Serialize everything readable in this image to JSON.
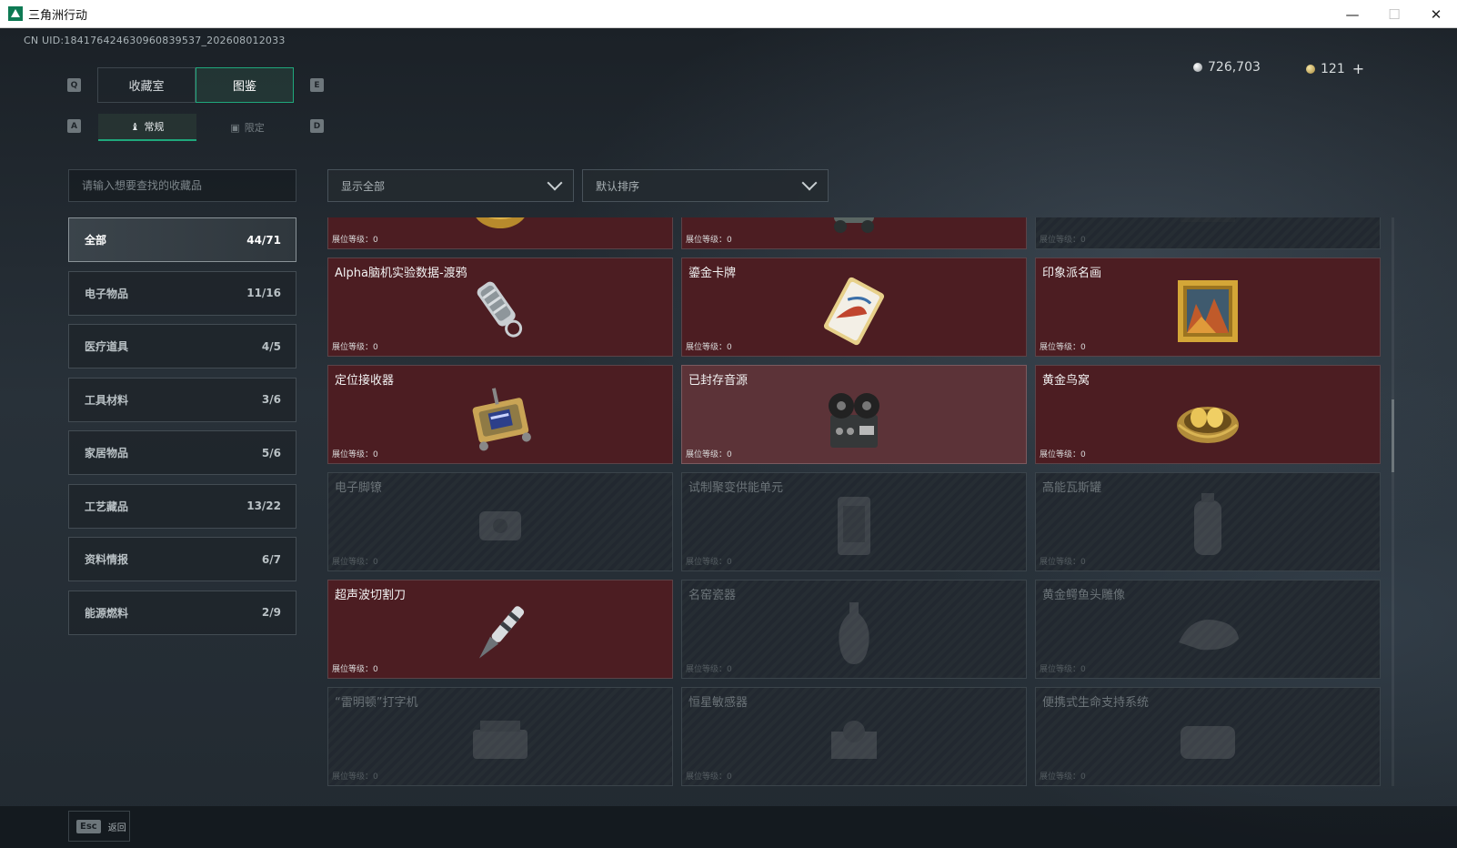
{
  "window": {
    "title": "三角洲行动",
    "minimize": "—",
    "maximize": "☐",
    "close": "✕"
  },
  "uid": "CN UID:184176424630960839537_202608012033",
  "currency": {
    "silver": "726,703",
    "gold": "121",
    "add": "+"
  },
  "keys": {
    "prev_main": "Q",
    "next_main": "E",
    "prev_sub": "A",
    "next_sub": "D"
  },
  "tabs": {
    "main": [
      {
        "label": "收藏室"
      },
      {
        "label": "图鉴"
      }
    ],
    "sub": [
      {
        "label": "常规",
        "icon": "♝"
      },
      {
        "label": "限定",
        "icon": "▣"
      }
    ]
  },
  "search": {
    "placeholder": "请输入想要查找的收藏品"
  },
  "filters": {
    "display": "显示全部",
    "sort": "默认排序"
  },
  "categories": [
    {
      "label": "全部",
      "count": "44/71"
    },
    {
      "label": "电子物品",
      "count": "11/16"
    },
    {
      "label": "医疗道具",
      "count": "4/5"
    },
    {
      "label": "工具材料",
      "count": "3/6"
    },
    {
      "label": "家居物品",
      "count": "5/6"
    },
    {
      "label": "工艺藏品",
      "count": "13/22"
    },
    {
      "label": "资料情报",
      "count": "6/7"
    },
    {
      "label": "能源燃料",
      "count": "2/9"
    }
  ],
  "level_label": "展位等级：",
  "items": [
    {
      "name": "",
      "level": "0",
      "icon": "caviar-tin-icon"
    },
    {
      "name": "",
      "level": "0",
      "icon": "robot-device-icon"
    },
    {
      "name": "",
      "level": "0",
      "icon": "unknown-item-icon"
    },
    {
      "name": "Alpha脑机实验数据-渡鸦",
      "level": "0",
      "icon": "flash-drive-icon"
    },
    {
      "name": "鎏金卡牌",
      "level": "0",
      "icon": "gilded-card-icon"
    },
    {
      "name": "印象派名画",
      "level": "0",
      "icon": "framed-painting-icon"
    },
    {
      "name": "定位接收器",
      "level": "0",
      "icon": "gps-receiver-icon"
    },
    {
      "name": "已封存音源",
      "level": "0",
      "icon": "reel-recorder-icon"
    },
    {
      "name": "黄金鸟窝",
      "level": "0",
      "icon": "golden-nest-icon"
    },
    {
      "name": "电子脚镣",
      "level": "0",
      "icon": "ankle-monitor-icon"
    },
    {
      "name": "试制聚变供能单元",
      "level": "0",
      "icon": "fusion-cell-icon"
    },
    {
      "name": "高能瓦斯罐",
      "level": "0",
      "icon": "gas-canister-icon"
    },
    {
      "name": "超声波切割刀",
      "level": "0",
      "icon": "ultrasonic-knife-icon"
    },
    {
      "name": "名窑瓷器",
      "level": "0",
      "icon": "porcelain-vase-icon"
    },
    {
      "name": "黄金鳄鱼头雕像",
      "level": "0",
      "icon": "golden-crocodile-icon"
    },
    {
      "name": "“雷明顿”打字机",
      "level": "0",
      "icon": "typewriter-icon"
    },
    {
      "name": "恒星敏感器",
      "level": "0",
      "icon": "star-sensor-icon"
    },
    {
      "name": "便携式生命支持系统",
      "level": "0",
      "icon": "life-support-icon"
    }
  ],
  "footer": {
    "esc_key": "Esc",
    "back_label": "返回"
  },
  "colors": {
    "accent": "#1fa87c",
    "card_unlocked": "#4c1d22",
    "card_locked": "#262d33"
  }
}
